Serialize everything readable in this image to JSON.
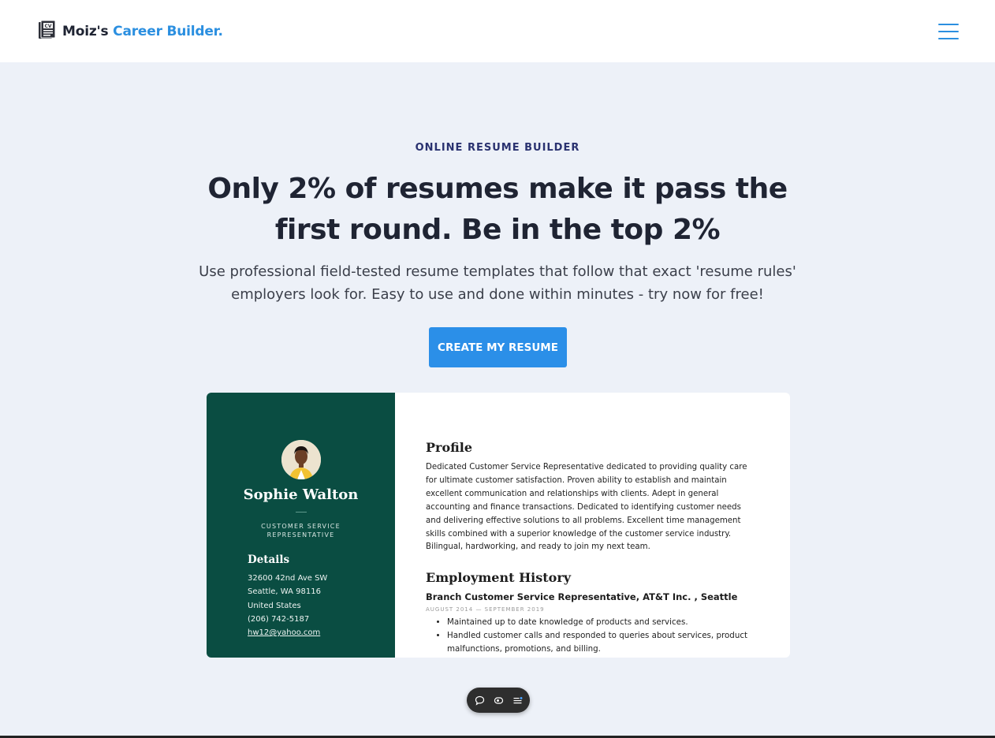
{
  "header": {
    "logo_icon": "resume-document-icon",
    "brand_prefix": "Moiz's",
    "brand_accent": "Career Builder.",
    "menu_icon": "hamburger-menu-icon"
  },
  "hero": {
    "eyebrow": "ONLINE RESUME BUILDER",
    "headline": "Only 2% of resumes make it pass the first round. Be in the top 2%",
    "subtext": "Use professional field-tested resume templates that follow that exact 'resume rules' employers look for. Easy to use and done within minutes - try now for free!",
    "cta_label": "CREATE MY RESUME"
  },
  "resume": {
    "name": "Sophie Walton",
    "role": "CUSTOMER SERVICE REPRESENTATIVE",
    "details_title": "Details",
    "details": [
      "32600 42nd Ave SW",
      "Seattle, WA 98116",
      "United States",
      "(206) 742-5187"
    ],
    "email": "hw12@yahoo.com",
    "profile_title": "Profile",
    "profile_text": "Dedicated Customer Service Representative dedicated to providing quality care for ultimate customer satisfaction. Proven ability to establish and maintain excellent communication and relationships with clients. Adept in general accounting and finance transactions. Dedicated to identifying customer needs and delivering effective solutions to all problems. Excellent time management skills combined with a superior knowledge of the customer service industry. Bilingual, hardworking, and ready to join my next team.",
    "employment_title": "Employment History",
    "job_title": "Branch Customer Service Representative, AT&T Inc. , Seattle",
    "job_dates": "AUGUST 2014 — SEPTEMBER 2019",
    "bullets": [
      "Maintained up to date knowledge of products and services.",
      "Handled customer calls and responded to queries about services, product malfunctions, promotions, and billing."
    ]
  },
  "floating_toolbar": {
    "icons": [
      "comment-icon",
      "screen-record-icon",
      "list-menu-icon"
    ]
  },
  "colors": {
    "accent": "#2b8fe8",
    "resume_sidebar": "#0a4d42",
    "background": "#edf1f8"
  }
}
